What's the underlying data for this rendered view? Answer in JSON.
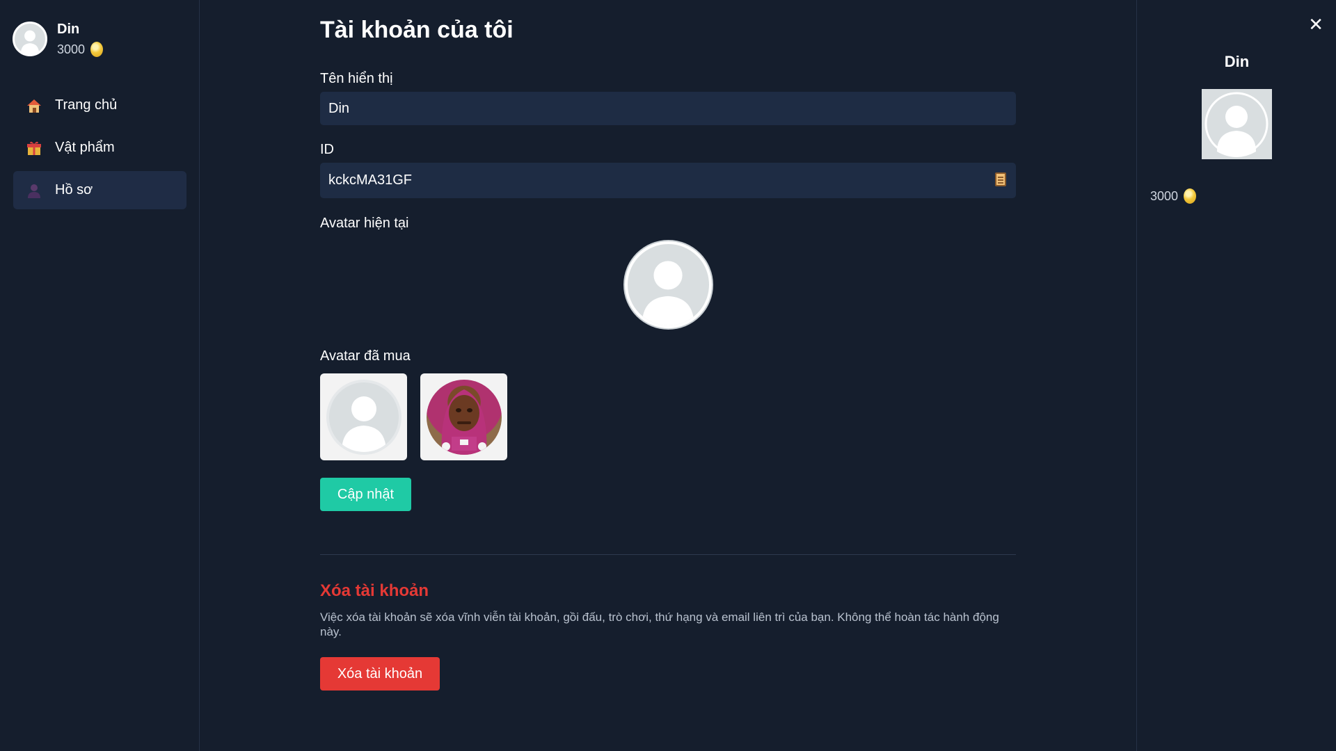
{
  "user": {
    "name": "Din",
    "coins": "3000"
  },
  "sidebar": {
    "items": [
      {
        "label": "Trang chủ",
        "icon": "house-icon"
      },
      {
        "label": "Vật phẩm",
        "icon": "gift-icon"
      },
      {
        "label": "Hồ sơ",
        "icon": "person-icon",
        "active": true
      }
    ]
  },
  "main": {
    "title": "Tài khoản của tôi",
    "display_name_label": "Tên hiển thị",
    "display_name_value": "Din",
    "id_label": "ID",
    "id_value": "kckcMA31GF",
    "current_avatar_label": "Avatar hiện tại",
    "owned_avatars_label": "Avatar đã mua",
    "owned_avatars": [
      "default-avatar",
      "character-avatar"
    ],
    "update_button": "Cập nhật",
    "delete_section_title": "Xóa tài khoản",
    "delete_section_desc": "Việc xóa tài khoản sẽ xóa vĩnh viễn tài khoản, gồi đấu, trò chơi, thứ hạng và email liên trì của bạn. Không thể hoàn tác hành động này.",
    "delete_button": "Xóa tài khoản"
  },
  "right_panel": {
    "name": "Din",
    "coins": "3000"
  },
  "colors": {
    "background": "#151e2d",
    "input_bg": "#1e2c44",
    "accent": "#1fcaa5",
    "danger": "#e53935"
  }
}
